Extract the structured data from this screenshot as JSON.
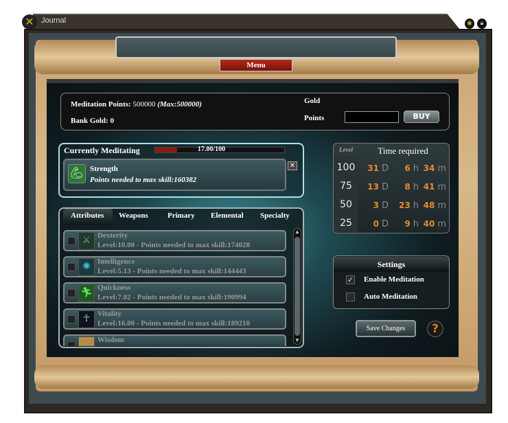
{
  "window": {
    "title": "Journal",
    "close_icon": "close-x-icon",
    "icons": [
      "eye-icon",
      "lock-icon"
    ]
  },
  "menu_label": "Menu",
  "info": {
    "meditation_label": "Meditation Points:",
    "meditation_value": "500000",
    "meditation_max": "(Max:500000)",
    "bank_gold": "Bank Gold: 0",
    "gold_label": "Gold",
    "points_label": "Points",
    "points_input": "",
    "buy_label": "BUY"
  },
  "current": {
    "title": "Currently Meditating",
    "progress_text": "17.00/100",
    "progress": 0.17,
    "skill": "Strength",
    "detail": "Points needed to max skill:160382"
  },
  "tabs": [
    "Attributes",
    "Weapons",
    "Primary",
    "Elemental",
    "Specialty"
  ],
  "active_tab": "Attributes",
  "skills": [
    {
      "name": "Dexterity",
      "detail": "Level:10.00 - Points needed to max skill:174028",
      "icon": "crossed-swords-icon"
    },
    {
      "name": "Intelligence",
      "detail": "Level:5.13 - Points needed to max skill:144443",
      "icon": "brain-icon"
    },
    {
      "name": "Quickness",
      "detail": "Level:7.02 - Points needed to max skill:190994",
      "icon": "running-man-icon"
    },
    {
      "name": "Vitality",
      "detail": "Level:16.00 - Points needed to max skill:189210",
      "icon": "ankh-icon"
    },
    {
      "name": "Wisdom",
      "detail": "",
      "icon": "book-icon"
    }
  ],
  "time": {
    "level_header": "Level",
    "header": "Time required",
    "units": [
      "D",
      "h",
      "m"
    ],
    "rows": [
      {
        "level": "100",
        "d": "31",
        "h": "6",
        "m": "34"
      },
      {
        "level": "75",
        "d": "13",
        "h": "8",
        "m": "41"
      },
      {
        "level": "50",
        "d": "3",
        "h": "23",
        "m": "48"
      },
      {
        "level": "25",
        "d": "0",
        "h": "9",
        "m": "40"
      }
    ]
  },
  "settings": {
    "title": "Settings",
    "enable": "Enable Meditation",
    "enable_checked": true,
    "auto": "Auto Meditation",
    "auto_checked": false
  },
  "save_label": "Save Changes",
  "help_label": "?",
  "colors": {
    "accent": "#e88a2c",
    "menu": "#a02010",
    "parchment": "#caa574"
  }
}
